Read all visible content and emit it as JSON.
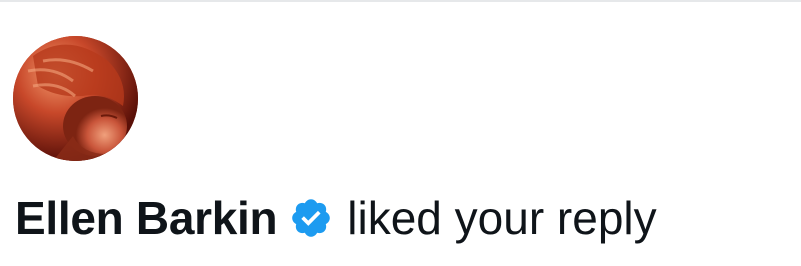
{
  "notification": {
    "user_name": "Ellen Barkin",
    "verified_icon": "verified-badge-icon",
    "action_text": "liked your reply",
    "avatar_icon": "profile-photo"
  },
  "colors": {
    "text": "#0f1419",
    "verified": "#1d9bf0",
    "divider": "#e6e8ea"
  }
}
